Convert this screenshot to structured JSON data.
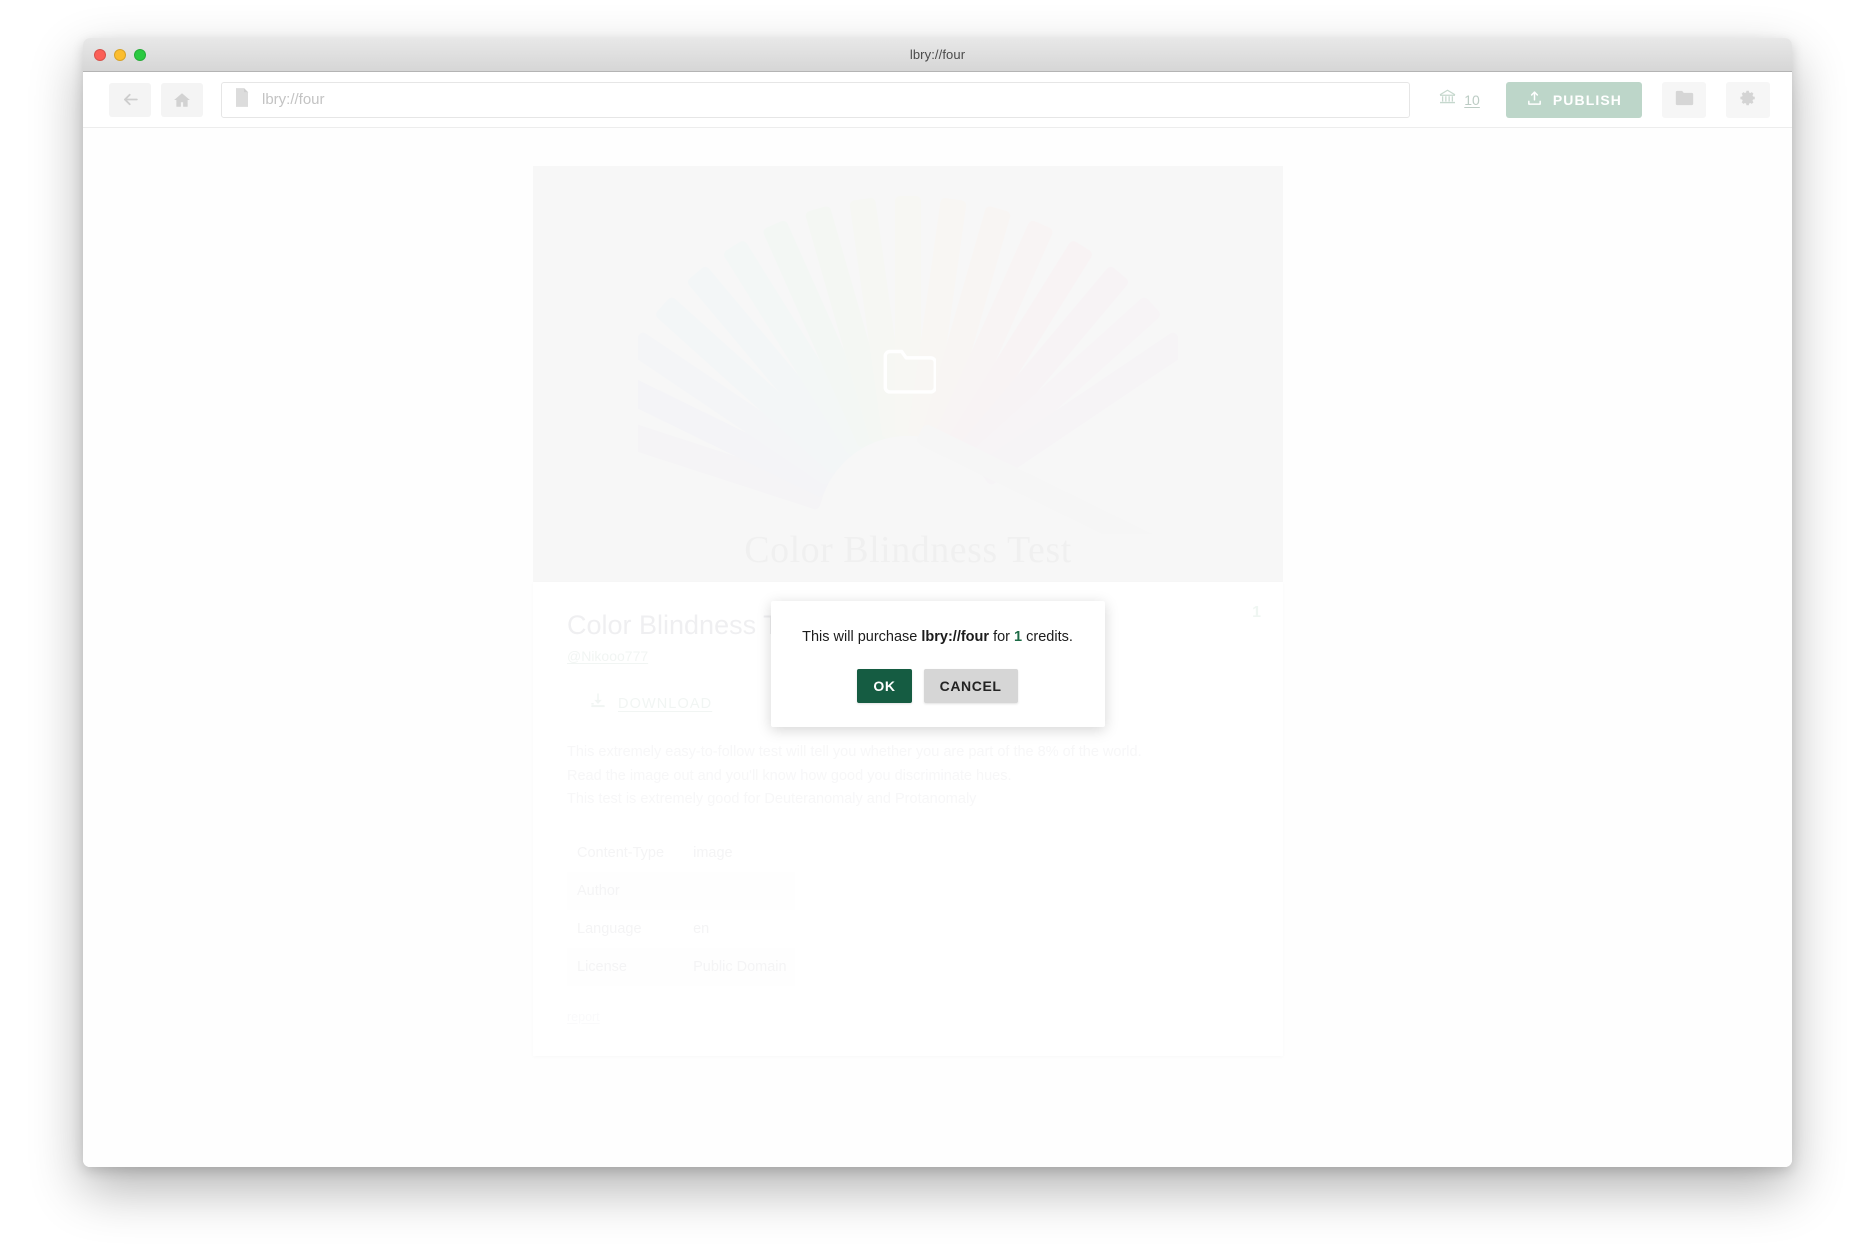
{
  "window": {
    "title": "lbry://four",
    "traffic_lights": [
      "close-red",
      "minimize-yellow",
      "maximize-green"
    ]
  },
  "toolbar": {
    "back_icon": "arrow-left-icon",
    "home_icon": "home-icon",
    "address": {
      "file_icon": "file-icon",
      "value": "lbry://four",
      "placeholder": "lbry://four"
    },
    "wallet": {
      "icon": "bank-icon",
      "amount": "10"
    },
    "publish": {
      "icon": "upload-icon",
      "label": "PUBLISH"
    },
    "folder_icon": "folder-icon",
    "settings_icon": "gear-icon"
  },
  "hero": {
    "caption": "Color Blindness Test",
    "center_icon": "folder-outline-icon"
  },
  "detail": {
    "price_badge": "1",
    "title": "Color Blindness Test",
    "channel": "@Nikooo777",
    "download": {
      "icon": "download-icon",
      "label": "DOWNLOAD"
    },
    "description": [
      "This extremely easy-to-follow test will tell you whether you are part of the 8% of the world.",
      "Read the image out and you'll know how good you discriminate hues.",
      "This test is extremely good for Deuteranomaly and Protanomaly"
    ],
    "metadata": [
      {
        "label": "Content-Type",
        "value": "image"
      },
      {
        "label": "Author",
        "value": ""
      },
      {
        "label": "Language",
        "value": "en"
      },
      {
        "label": "License",
        "value": "Public Domain"
      }
    ],
    "report_label": "report"
  },
  "modal": {
    "message_prefix": "This will purchase ",
    "message_claim": "lbry://four",
    "message_middle": " for ",
    "message_credits": "1",
    "message_suffix": " credits.",
    "ok_label": "OK",
    "cancel_label": "CANCEL"
  },
  "colors": {
    "accent_green": "#155c42",
    "brand_muted_green": "#bdd6c9",
    "credits_green": "#1d6b46",
    "hero_background": "#e2e2e2",
    "page_background": "#fafafa"
  }
}
